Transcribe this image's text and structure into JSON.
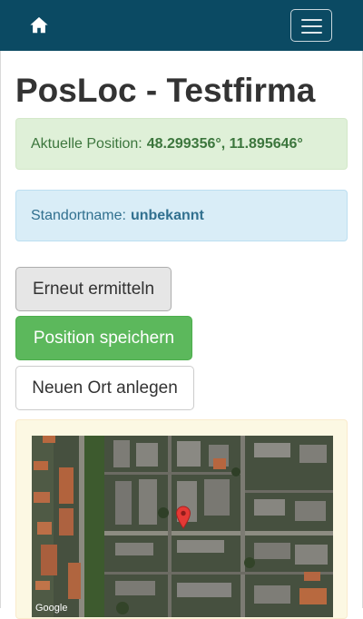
{
  "navbar": {
    "home_icon": "home-icon",
    "menu_icon": "hamburger-menu-icon",
    "background": "#0b4a63"
  },
  "page": {
    "title": "PosLoc - Testfirma"
  },
  "position_alert": {
    "label": "Aktuelle Position:",
    "value": "48.299356°, 11.895646°"
  },
  "location_alert": {
    "label": "Standortname:",
    "value": "unbekannt"
  },
  "buttons": {
    "redetermine": "Erneut ermitteln",
    "save_position": "Position speichern",
    "new_location": "Neuen Ort anlegen"
  },
  "map": {
    "attribution": "Google",
    "marker_icon": "map-pin-icon",
    "marker_color": "#e53935"
  }
}
